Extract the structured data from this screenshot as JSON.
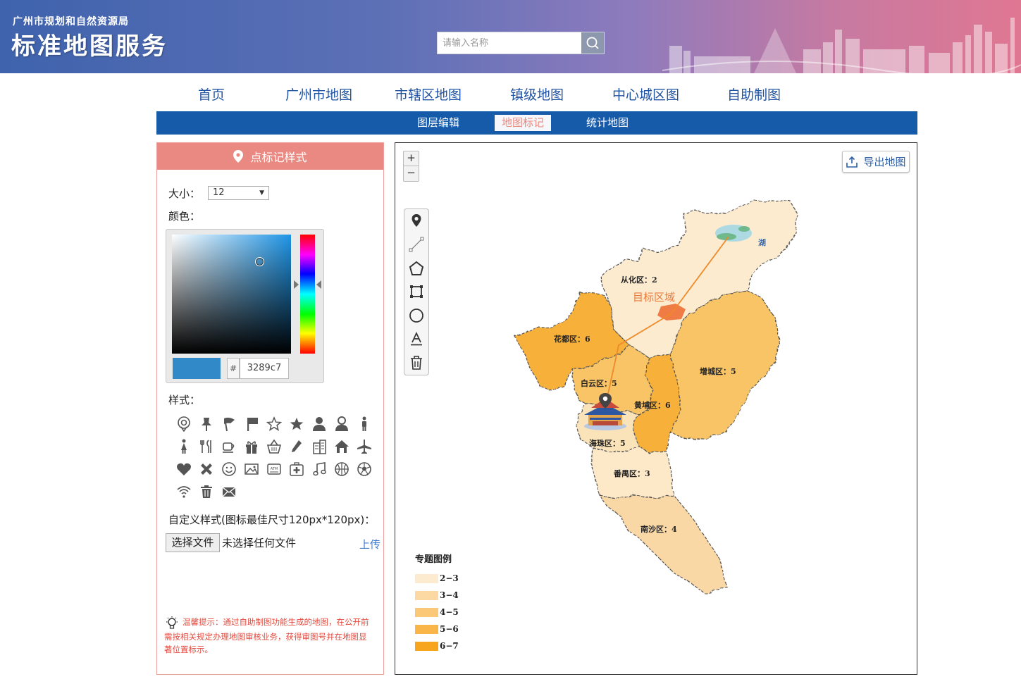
{
  "header": {
    "org": "广州市规划和自然资源局",
    "brand": "标准地图服务",
    "search_placeholder": "请输入名称"
  },
  "nav": {
    "items": [
      "首页",
      "广州市地图",
      "市辖区地图",
      "镇级地图",
      "中心城区图",
      "自助制图"
    ]
  },
  "subnav": {
    "items": [
      "图层编辑",
      "地图标记",
      "统计地图"
    ],
    "active": "地图标记"
  },
  "panel": {
    "title": "点标记样式",
    "size_label": "大小：",
    "size_value": "12",
    "color_label": "颜色：",
    "hash": "#",
    "color_hex": "3289c7",
    "color_value": "#3289c7",
    "style_label": "样式：",
    "style_icons": [
      "location-pin",
      "pushpin",
      "flag-wave",
      "flag",
      "star-outline",
      "star",
      "person-female",
      "person-male",
      "person-standing",
      "person-female-standing",
      "utensils",
      "coffee-cup",
      "gift",
      "basket",
      "pen",
      "building",
      "home",
      "airplane",
      "heart",
      "close-x",
      "smiley",
      "image",
      "atm",
      "medical-kit",
      "music-note",
      "basketball",
      "soccer-ball",
      "wifi",
      "trash",
      "mail"
    ],
    "custom_label": "自定义样式(图标最佳尺寸120px*120px)：",
    "file_button": "选择文件",
    "file_none": "未选择任何文件",
    "upload": "上传",
    "tip_line1": "温馨提示：通过自助制图功能生成的地图，在公开前",
    "tip_line2": "需按相关规定办理地图审核业务，获得审图号并在地图显",
    "tip_line3": "著位置标示。"
  },
  "map": {
    "zoom_in": "+",
    "zoom_out": "−",
    "export": "导出地图",
    "target_label": "目标区域",
    "lake_label": "湖",
    "districts": [
      {
        "name": "从化区：",
        "value": "2"
      },
      {
        "name": "花都区：",
        "value": "6"
      },
      {
        "name": "白云区：",
        "value": "5"
      },
      {
        "name": "增城区：",
        "value": "5"
      },
      {
        "name": "黄埔区：",
        "value": "6"
      },
      {
        "name": "海珠区：",
        "value": "5"
      },
      {
        "name": "番禺区：",
        "value": "3"
      },
      {
        "name": "南沙区：",
        "value": "4"
      }
    ],
    "legend": {
      "title": "专题图例",
      "items": [
        {
          "label": "2−3",
          "color": "#fdebd0"
        },
        {
          "label": "3−4",
          "color": "#fcd9a3"
        },
        {
          "label": "4−5",
          "color": "#fbc878"
        },
        {
          "label": "5−6",
          "color": "#f9b548"
        },
        {
          "label": "6−7",
          "color": "#f6a51d"
        }
      ]
    }
  }
}
